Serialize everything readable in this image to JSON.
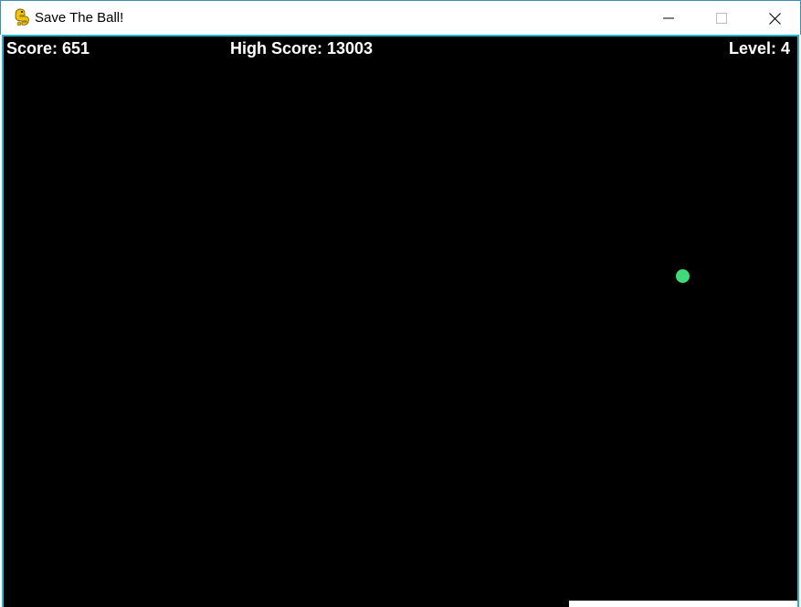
{
  "window": {
    "title": "Save The Ball!",
    "icon": "python-snake-icon",
    "controls": {
      "minimize": "minimize-icon",
      "maximize": "maximize-icon",
      "close": "close-icon"
    }
  },
  "hud": {
    "score": "Score: 651",
    "high_score": "High Score: 13003",
    "level": "Level: 4"
  },
  "colors": {
    "background": "#000000",
    "border": "#1fb7c9",
    "ball": "#3ddc78",
    "paddle": "#ffffff",
    "hud_text": "#ffffff"
  }
}
